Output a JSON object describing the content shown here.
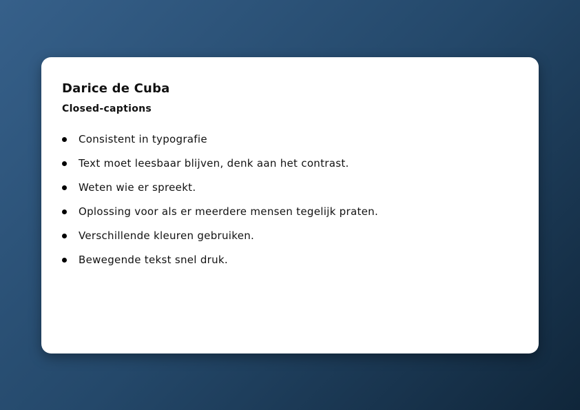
{
  "card": {
    "title": "Darice de Cuba",
    "subtitle": "Closed-captions",
    "items": [
      "Consistent in typografie",
      "Text moet leesbaar blijven, denk aan het contrast.",
      "Weten wie er spreekt.",
      "Oplossing voor als er meerdere mensen tegelijk praten.",
      "Verschillende kleuren gebruiken.",
      "Bewegende tekst snel druk."
    ]
  },
  "colors": {
    "background_start": "#36608a",
    "background_end": "#10263a",
    "card": "#ffffff",
    "text": "#111111"
  }
}
